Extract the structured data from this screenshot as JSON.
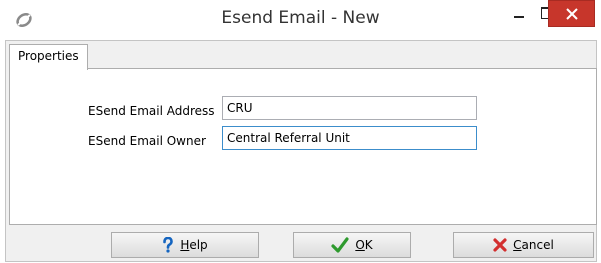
{
  "window": {
    "title": "Esend Email - New",
    "app_icon": "app-logo-icon",
    "controls": {
      "minimize": "minimize-icon",
      "maximize": "maximize-icon",
      "close": "close-icon"
    },
    "close_color": "#c7362b"
  },
  "tabs": [
    {
      "label": "Properties",
      "active": true
    }
  ],
  "form": {
    "address_label": "ESend Email Address",
    "address_value": "CRU",
    "owner_label": "ESend Email Owner",
    "owner_value": "Central Referral Unit"
  },
  "buttons": {
    "help": {
      "mnemonic": "H",
      "rest": "elp",
      "icon": "question-mark-icon",
      "icon_color": "#1565c0"
    },
    "ok": {
      "mnemonic": "O",
      "rest": "K",
      "icon": "checkmark-icon",
      "icon_color": "#2e9a2e"
    },
    "cancel": {
      "mnemonic": "C",
      "rest": "ancel",
      "icon": "x-mark-icon",
      "icon_color": "#d32f2f"
    }
  }
}
